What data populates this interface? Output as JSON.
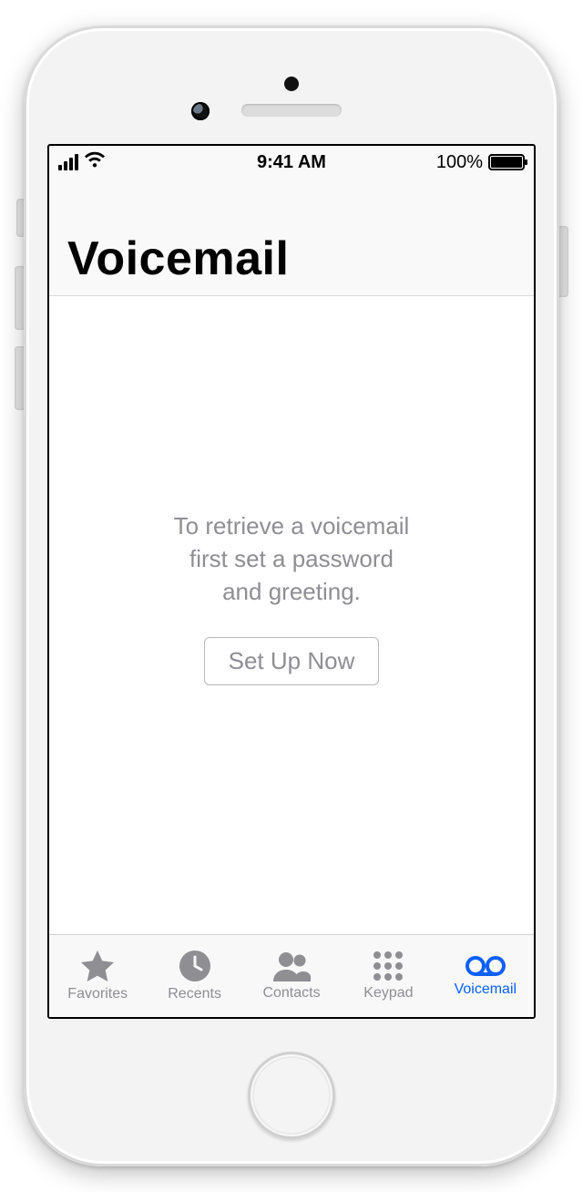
{
  "status": {
    "time": "9:41 AM",
    "battery_pct": "100%"
  },
  "header": {
    "title": "Voicemail"
  },
  "body": {
    "message": "To retrieve a voicemail\nfirst set a password\nand greeting.",
    "cta_label": "Set Up Now"
  },
  "tabs": [
    {
      "label": "Favorites",
      "active": false
    },
    {
      "label": "Recents",
      "active": false
    },
    {
      "label": "Contacts",
      "active": false
    },
    {
      "label": "Keypad",
      "active": false
    },
    {
      "label": "Voicemail",
      "active": true
    }
  ],
  "colors": {
    "accent": "#0b60ff",
    "inactive": "#8e8e93"
  }
}
